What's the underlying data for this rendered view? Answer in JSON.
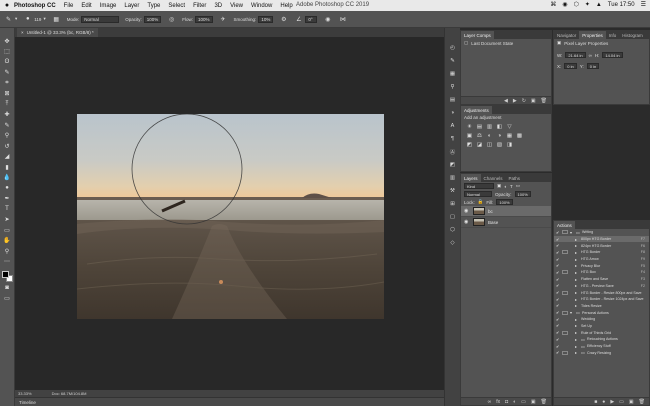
{
  "menubar": {
    "apple": "",
    "items": [
      "Photoshop CC",
      "File",
      "Edit",
      "Image",
      "Layer",
      "Type",
      "Select",
      "Filter",
      "3D",
      "View",
      "Window",
      "Help"
    ],
    "center_title": "Adobe Photoshop CC 2019",
    "clock": "Tue 17:50",
    "status_icons": [
      "⌘",
      "◉",
      "⬡",
      "✦",
      "▲",
      "☰"
    ]
  },
  "options": {
    "brush_size": "119",
    "mode_label": "Mode:",
    "mode_value": "Normal",
    "opacity_label": "Opacity:",
    "opacity_value": "100%",
    "flow_label": "Flow:",
    "flow_value": "100%",
    "smoothing_label": "Smoothing:",
    "smoothing_value": "10%",
    "angle_value": "0°"
  },
  "document": {
    "tab_label": "Untitled-1 @ 33.3% (bc, RGB/8) *",
    "close": "×"
  },
  "status": {
    "zoom": "33.33%",
    "doc": "Doc: 68.7M/104.8M",
    "timeline_label": "Timeline"
  },
  "layer_comps": {
    "tab": "Layer Comps",
    "last_state": "Last Document State"
  },
  "properties": {
    "tabs": [
      "Navigator",
      "Properties",
      "Info",
      "Histogram"
    ],
    "active": "Properties",
    "heading": "Pixel Layer Properties",
    "w_label": "W:",
    "w_value": "21.64 in",
    "h_label": "H:",
    "h_value": "14.04 in",
    "x_label": "X:",
    "x_value": "0 in",
    "y_label": "Y:",
    "y_value": "0 in",
    "go_label": "GO"
  },
  "adjustments": {
    "tab": "Adjustments",
    "hint": "Add an adjustment",
    "icons": [
      "☀",
      "▤",
      "▥",
      "◧",
      "▽",
      "",
      "",
      "",
      "",
      "",
      "▣",
      "⚖",
      "◐",
      "◑",
      "▦",
      "▩",
      "",
      "",
      "",
      "",
      "◩",
      "◪",
      "◫",
      "▧",
      "◨",
      "",
      "",
      "",
      "",
      ""
    ]
  },
  "layers": {
    "tabs": [
      "Layers",
      "Channels",
      "Paths"
    ],
    "active": "Layers",
    "kind": "Kind",
    "blend": "Normal",
    "opacity_label": "Opacity:",
    "opacity_value": "100%",
    "lock_label": "Lock:",
    "fill_label": "Fill:",
    "fill_value": "100%",
    "rows": [
      {
        "name": "bc",
        "selected": true
      },
      {
        "name": "Base",
        "selected": false
      }
    ]
  },
  "actions": {
    "tab": "Actions",
    "rows": [
      {
        "label": "Writing",
        "key": "",
        "level": 0,
        "folder": true,
        "open": true,
        "selected": false
      },
      {
        "label": "800px HTG Border",
        "key": "F7",
        "level": 1,
        "folder": false,
        "open": false,
        "selected": true
      },
      {
        "label": "824px HTG Border",
        "key": "F6",
        "level": 1,
        "folder": false,
        "open": false,
        "selected": false
      },
      {
        "label": "HTG Border",
        "key": "F8",
        "level": 1,
        "folder": false,
        "open": false,
        "selected": false
      },
      {
        "label": "HTG Arrow",
        "key": "F9",
        "level": 1,
        "folder": false,
        "open": false,
        "selected": false
      },
      {
        "label": "Privacy Blur",
        "key": "F5",
        "level": 1,
        "folder": false,
        "open": false,
        "selected": false
      },
      {
        "label": "HTG Box",
        "key": "F4",
        "level": 1,
        "folder": false,
        "open": false,
        "selected": false
      },
      {
        "label": "Flatten and Save",
        "key": "F3",
        "level": 1,
        "folder": false,
        "open": false,
        "selected": false
      },
      {
        "label": "HTG - Preview Save",
        "key": "F2",
        "level": 1,
        "folder": false,
        "open": false,
        "selected": false
      },
      {
        "label": "HTG Border - Resize 800px and Save",
        "key": "",
        "level": 1,
        "folder": false,
        "open": false,
        "selected": false
      },
      {
        "label": "HTG Border - Resize 1024px and Save",
        "key": "",
        "level": 1,
        "folder": false,
        "open": false,
        "selected": false
      },
      {
        "label": "Tides Resize",
        "key": "",
        "level": 1,
        "folder": false,
        "open": false,
        "selected": false
      },
      {
        "label": "Personal Actions",
        "key": "",
        "level": 0,
        "folder": true,
        "open": true,
        "selected": false
      },
      {
        "label": "Wedding",
        "key": "",
        "level": 1,
        "folder": false,
        "open": false,
        "selected": false
      },
      {
        "label": "Set Up",
        "key": "",
        "level": 1,
        "folder": false,
        "open": false,
        "selected": false
      },
      {
        "label": "Rule of Thirds Grid",
        "key": "",
        "level": 1,
        "folder": false,
        "open": false,
        "selected": false
      },
      {
        "label": "Retouching Actions",
        "key": "",
        "level": 1,
        "folder": true,
        "open": false,
        "selected": false
      },
      {
        "label": "Efficiency Stuff",
        "key": "",
        "level": 1,
        "folder": true,
        "open": false,
        "selected": false
      },
      {
        "label": "Crazy Resizing",
        "key": "",
        "level": 1,
        "folder": true,
        "open": false,
        "selected": false
      }
    ],
    "foot_icons": [
      "■",
      "●",
      "▶",
      "▭",
      "▣",
      "🗑"
    ]
  }
}
